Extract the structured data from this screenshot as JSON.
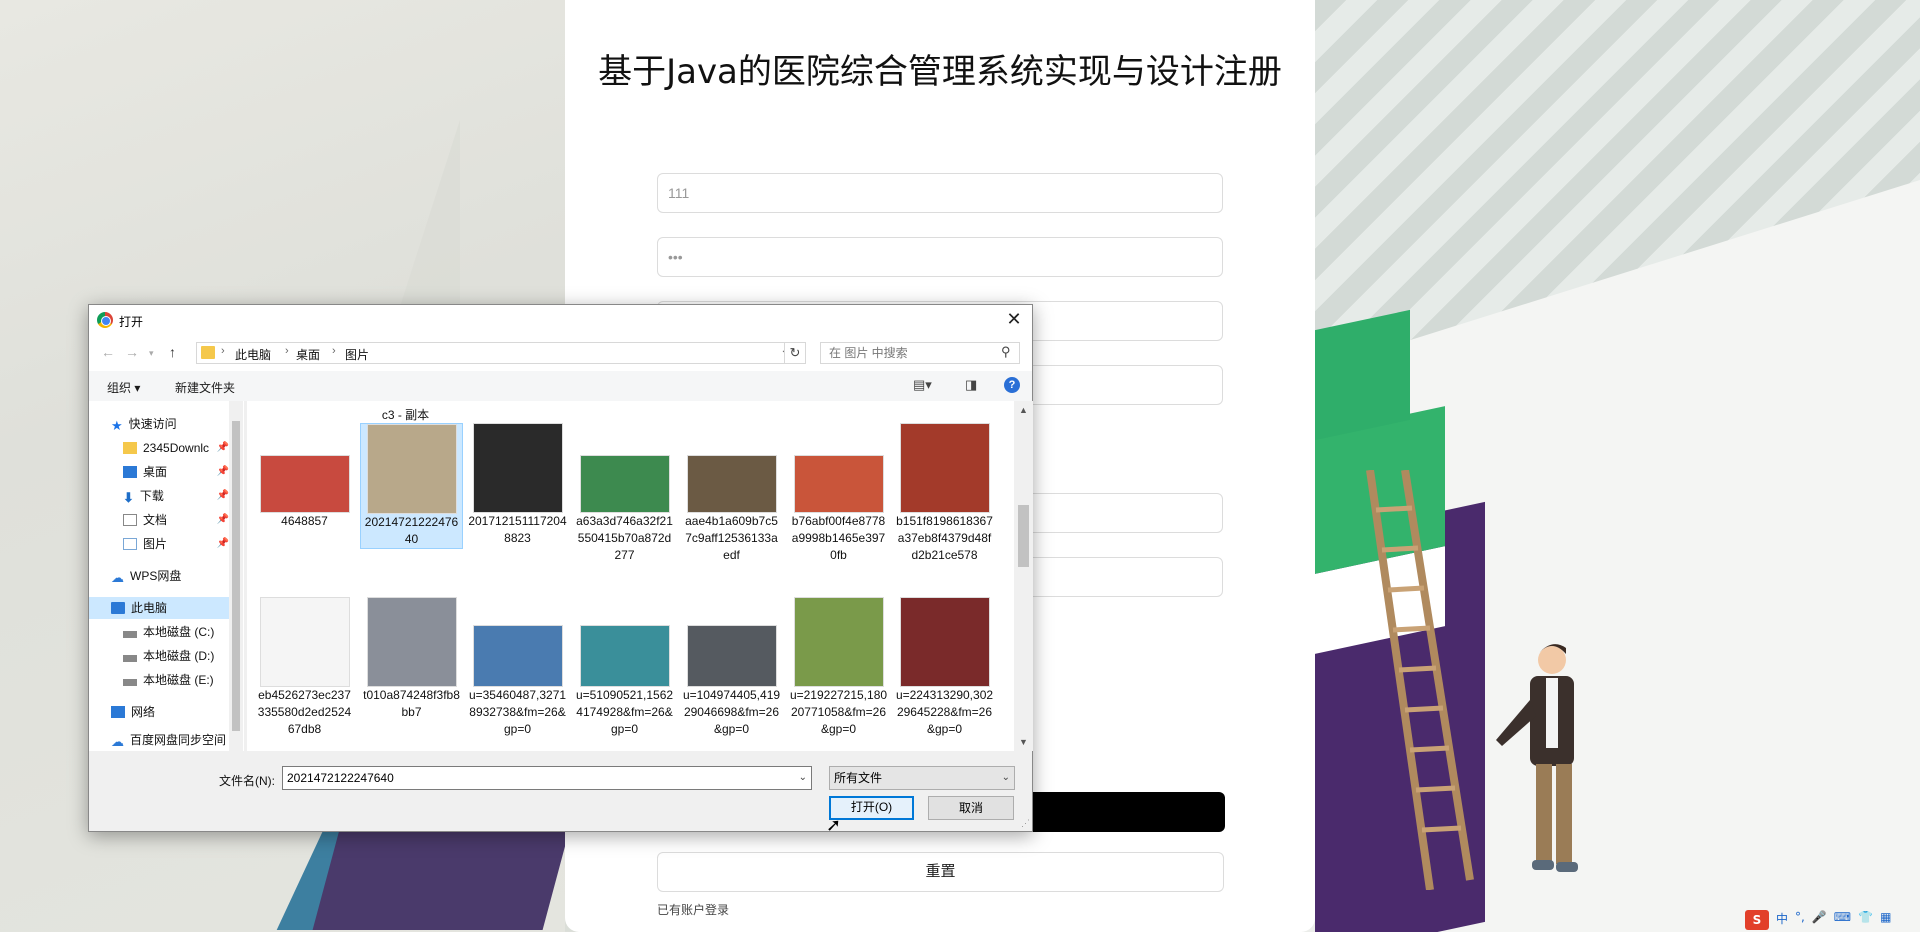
{
  "register": {
    "title": "基于Java的医院综合管理系统实现与设计注册",
    "username_value": "111",
    "password_value": "•••",
    "reset_label": "重置",
    "login_link": "已有账户登录"
  },
  "dialog": {
    "title": "打开",
    "breadcrumbs": [
      "此电脑",
      "桌面",
      "图片"
    ],
    "search_placeholder": "在 图片 中搜索",
    "toolbar": {
      "organize": "组织 ▾",
      "new_folder": "新建文件夹"
    },
    "nav": [
      {
        "label": "快速访问",
        "icon": "star-icon"
      },
      {
        "label": "2345Downlc",
        "icon": "folder-icon"
      },
      {
        "label": "桌面",
        "icon": "desktop-icon"
      },
      {
        "label": "下载",
        "icon": "download-icon"
      },
      {
        "label": "文档",
        "icon": "document-icon"
      },
      {
        "label": "图片",
        "icon": "pictures-icon"
      },
      {
        "label": "WPS网盘",
        "icon": "cloud-icon"
      },
      {
        "label": "此电脑",
        "icon": "computer-icon"
      },
      {
        "label": "本地磁盘 (C:)",
        "icon": "disk-icon"
      },
      {
        "label": "本地磁盘 (D:)",
        "icon": "disk-icon"
      },
      {
        "label": "本地磁盘 (E:)",
        "icon": "disk-icon"
      },
      {
        "label": "网络",
        "icon": "network-icon"
      },
      {
        "label": "百度网盘同步空间",
        "icon": "cloud-icon"
      }
    ],
    "partial_row": [
      "c3 - 副本"
    ],
    "files": [
      {
        "name": "4648857",
        "color": "#c84a3f"
      },
      {
        "name": "2021472122247640",
        "color": "#b8a88a"
      },
      {
        "name": "2017121511172048823",
        "color": "#2a2a2a"
      },
      {
        "name": "a63a3d746a32f21550415b70a872d277",
        "color": "#3d8a4f"
      },
      {
        "name": "aae4b1a609b7c57c9aff12536133aedf",
        "color": "#6b5a44"
      },
      {
        "name": "b76abf00f4e8778a9998b1465e3970fb",
        "color": "#c9553a"
      },
      {
        "name": "b151f8198618367a37eb8f4379d48fd2b21ce578",
        "color": "#a33a2a"
      },
      {
        "name": "eb4526273ec237335580d2ed252467db8",
        "color": "#f5f5f5"
      },
      {
        "name": "t010a874248f3fb8bb7",
        "color": "#8a8f99"
      },
      {
        "name": "u=35460487,32718932738&fm=26&gp=0",
        "color": "#4a7bb0"
      },
      {
        "name": "u=51090521,15624174928&fm=26&gp=0",
        "color": "#3a8f9a"
      },
      {
        "name": "u=104974405,41929046698&fm=26&gp=0",
        "color": "#555a60"
      },
      {
        "name": "u=219227215,18020771058&fm=26&gp=0",
        "color": "#7a9a4a"
      },
      {
        "name": "u=224313290,30229645228&fm=26&gp=0",
        "color": "#7a2a2a"
      }
    ],
    "filename_label": "文件名(N):",
    "filename_value": "2021472122247640",
    "filetype_value": "所有文件",
    "open_label": "打开(O)",
    "cancel_label": "取消"
  },
  "ime": {
    "logo": "S",
    "lang": "中",
    "items": [
      "°,",
      "🎤",
      "⌨",
      "👕",
      "▦"
    ]
  }
}
